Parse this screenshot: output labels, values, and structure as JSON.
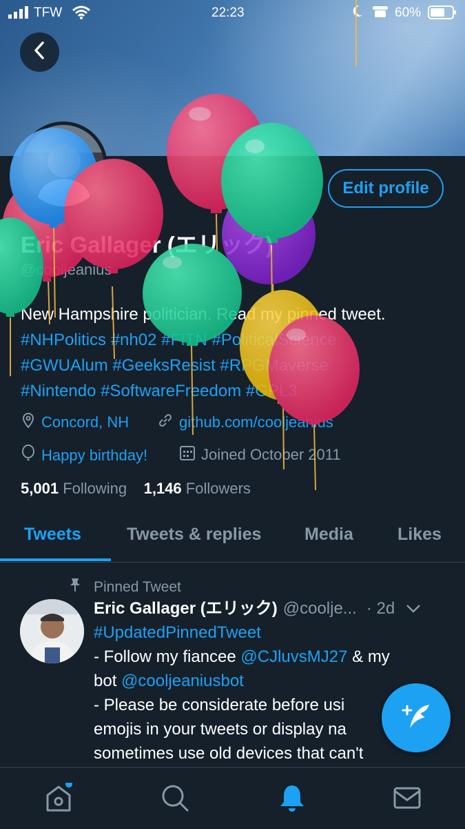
{
  "status_bar": {
    "carrier": "TFW",
    "time": "22:23",
    "battery": "60%"
  },
  "profile": {
    "display_name": "Eric Gallager (エリック)",
    "handle": "@cooljeanius",
    "edit_profile_label": "Edit profile",
    "bio_text": "New Hampshire politician. Read my pinned tweet.",
    "bio_hashtags_line1": "#NHPolitics #nh02 #FITN #PoliticalScience",
    "bio_hashtags_line2": "#GWUAlum #GeeksResist #RPGMaverse",
    "bio_hashtags_line3": "#Nintendo #SoftwareFreedom #GPL3",
    "location": "Concord, NH",
    "website": "github.com/cooljeanius",
    "birthday": "Happy birthday!",
    "joined": "Joined October 2011",
    "following_count": "5,001",
    "following_label": "Following",
    "followers_count": "1,146",
    "followers_label": "Followers"
  },
  "tabs": [
    {
      "label": "Tweets",
      "active": true
    },
    {
      "label": "Tweets & replies",
      "active": false
    },
    {
      "label": "Media",
      "active": false
    },
    {
      "label": "Likes",
      "active": false
    }
  ],
  "pinned_tweet": {
    "pinned_label": "Pinned Tweet",
    "author_name": "Eric Gallager (エリック)",
    "author_handle": "@coolje...",
    "time": "· 2d",
    "line1": "#UpdatedPinnedTweet",
    "line2_prefix": "- Follow my fiancee ",
    "line2_mention": "@CJluvsMJ27",
    "line2_suffix": " & my",
    "line3_prefix": "bot ",
    "line3_mention": "@cooljeaniusbot",
    "line4": "- Please be considerate before usi",
    "line5": "emojis in your tweets or display na",
    "line6": "sometimes use old devices that can't"
  },
  "colors": {
    "accent": "#1da1f2",
    "background": "#15202b",
    "muted": "#8899a6"
  },
  "icons": {
    "back": "chevron-left-icon",
    "location": "location-pin-icon",
    "link": "link-icon",
    "birthday": "balloon-icon",
    "calendar": "calendar-icon",
    "pin": "pin-icon",
    "more": "chevron-down-icon",
    "compose": "compose-tweet-icon",
    "home": "home-icon",
    "search": "search-icon",
    "notifications": "bell-icon",
    "messages": "mail-icon"
  }
}
